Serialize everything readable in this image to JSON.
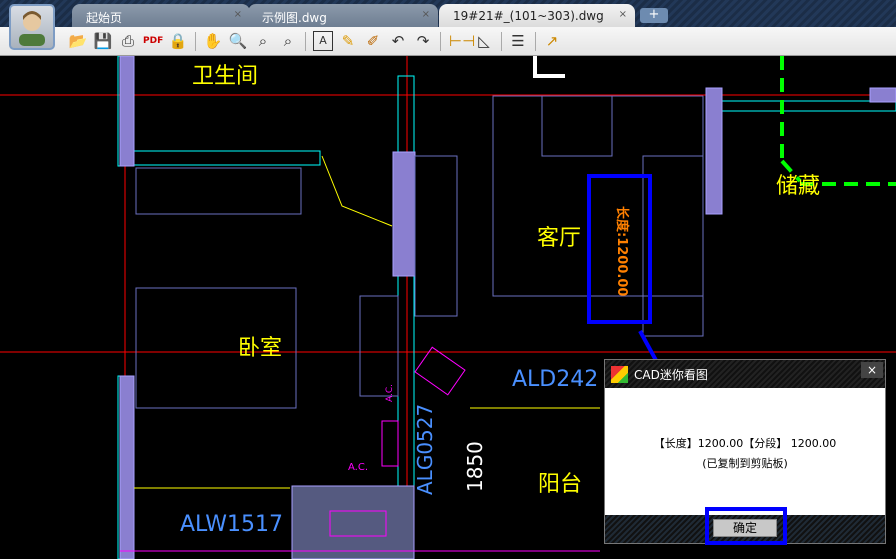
{
  "tabs": [
    {
      "label": "起始页",
      "close": "×"
    },
    {
      "label": "示例图.dwg",
      "close": "×"
    },
    {
      "label": "19#21#_(101~303).dwg",
      "close": "×",
      "active": true
    }
  ],
  "new_tab": "+",
  "cad": {
    "rooms": [
      "卫生间",
      "客厅",
      "储藏",
      "卧室",
      "阳台"
    ],
    "labels": [
      "ALD242",
      "ALW1517",
      "ALG0527",
      "1850",
      "A.C.",
      "A.C."
    ],
    "dimension": "长度:1200.00"
  },
  "dialog": {
    "title": "CAD迷你看图",
    "close": "×",
    "line1": "【长度】1200.00【分段】 1200.00",
    "line2": "(已复制到剪贴板)",
    "ok": "确定"
  },
  "colors": {
    "highlight": "#0000ff",
    "cad_bg": "#000000"
  }
}
